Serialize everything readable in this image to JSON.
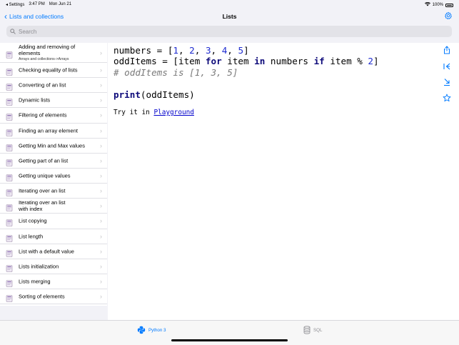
{
  "status": {
    "left": [
      "◂ Settings",
      "3:47 PM",
      "Mon Jun 21"
    ],
    "battery": "100%"
  },
  "nav": {
    "back_label": "Lists and collections",
    "title": "Lists"
  },
  "search": {
    "placeholder": "Search"
  },
  "sidebar": {
    "items": [
      {
        "label": "Adding and removing of elements",
        "sub": "Arrays and collections->Arrays"
      },
      {
        "label": "Checking equality of lists"
      },
      {
        "label": "Converting of an list"
      },
      {
        "label": "Dynamic lists"
      },
      {
        "label": "Filtering of elements"
      },
      {
        "label": "Finding an array element"
      },
      {
        "label": "Getting Min and Max values"
      },
      {
        "label": "Getting part of an list"
      },
      {
        "label": "Getting unique values"
      },
      {
        "label": "Iterating over an list"
      },
      {
        "label": "Iterating over an list with index"
      },
      {
        "label": "List copying"
      },
      {
        "label": "List length"
      },
      {
        "label": "List with a default value"
      },
      {
        "label": "Lists initialization"
      },
      {
        "label": "Lists merging"
      },
      {
        "label": "Sorting of elements"
      }
    ]
  },
  "code": {
    "try_prefix": "Try it in ",
    "try_link": "Playground"
  },
  "tabs": [
    {
      "label": "Python 3",
      "active": true
    },
    {
      "label": "SQL",
      "active": false
    }
  ],
  "colors": {
    "accent": "#007aff",
    "keyword": "#0d0a7a",
    "number": "#1e2bd0",
    "comment": "#7a7a7a",
    "link": "#0000cc"
  }
}
